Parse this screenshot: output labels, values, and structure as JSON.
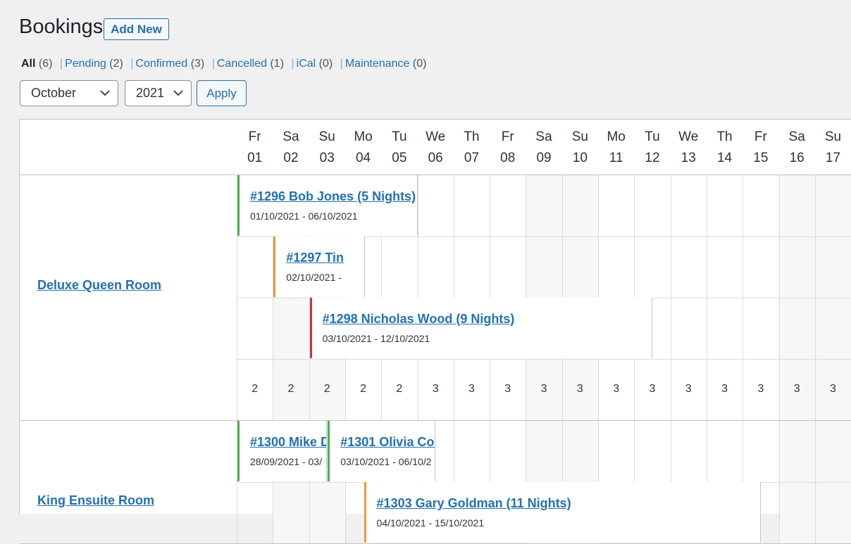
{
  "header": {
    "title": "Bookings",
    "add_new": "Add New"
  },
  "filters": [
    {
      "label": "All",
      "count": "(6)",
      "current": true
    },
    {
      "label": "Pending",
      "count": "(2)"
    },
    {
      "label": "Confirmed",
      "count": "(3)"
    },
    {
      "label": "Cancelled",
      "count": "(1)"
    },
    {
      "label": "iCal",
      "count": "(0)"
    },
    {
      "label": "Maintenance",
      "count": "(0)"
    }
  ],
  "controls": {
    "month": "October",
    "year": "2021",
    "apply": "Apply"
  },
  "days": [
    {
      "dow": "Fr",
      "num": "01"
    },
    {
      "dow": "Sa",
      "num": "02"
    },
    {
      "dow": "Su",
      "num": "03"
    },
    {
      "dow": "Mo",
      "num": "04"
    },
    {
      "dow": "Tu",
      "num": "05"
    },
    {
      "dow": "We",
      "num": "06"
    },
    {
      "dow": "Th",
      "num": "07"
    },
    {
      "dow": "Fr",
      "num": "08"
    },
    {
      "dow": "Sa",
      "num": "09"
    },
    {
      "dow": "Su",
      "num": "10"
    },
    {
      "dow": "Mo",
      "num": "11"
    },
    {
      "dow": "Tu",
      "num": "12"
    },
    {
      "dow": "We",
      "num": "13"
    },
    {
      "dow": "Th",
      "num": "14"
    },
    {
      "dow": "Fr",
      "num": "15"
    },
    {
      "dow": "Sa",
      "num": "16"
    },
    {
      "dow": "Su",
      "num": "17"
    }
  ],
  "rooms": [
    {
      "name": "Deluxe Queen Room",
      "rows": [
        {
          "bookings": [
            {
              "title": "#1296 Bob Jones (5 Nights)",
              "dates": "01/10/2021 - 06/10/2021",
              "status_color": "#46b450"
            }
          ]
        },
        {
          "bookings": [
            {
              "title": "#1297 Tin",
              "dates": "02/10/2021 -",
              "status_color": "#e89a3c"
            }
          ]
        },
        {
          "bookings": [
            {
              "title": "#1298 Nicholas Wood (9 Nights)",
              "dates": "03/10/2021 - 12/10/2021",
              "status_color": "#c9353d"
            }
          ]
        }
      ],
      "availability": [
        "2",
        "2",
        "2",
        "2",
        "2",
        "3",
        "3",
        "3",
        "3",
        "3",
        "3",
        "3",
        "3",
        "3",
        "3",
        "3",
        "3"
      ]
    },
    {
      "name": "King Ensuite Room",
      "rows": [
        {
          "bookings": [
            {
              "title": "#1300 Mike D",
              "dates": "28/09/2021 - 03/",
              "status_color": "#46b450"
            },
            {
              "title": "#1301 Olivia Col",
              "dates": "03/10/2021 - 06/10/2",
              "status_color": "#46b450"
            }
          ]
        },
        {
          "bookings": [
            {
              "title": "#1303 Gary Goldman (11 Nights)",
              "dates": "04/10/2021 - 15/10/2021",
              "status_color": "#e89a3c"
            }
          ]
        }
      ]
    }
  ]
}
